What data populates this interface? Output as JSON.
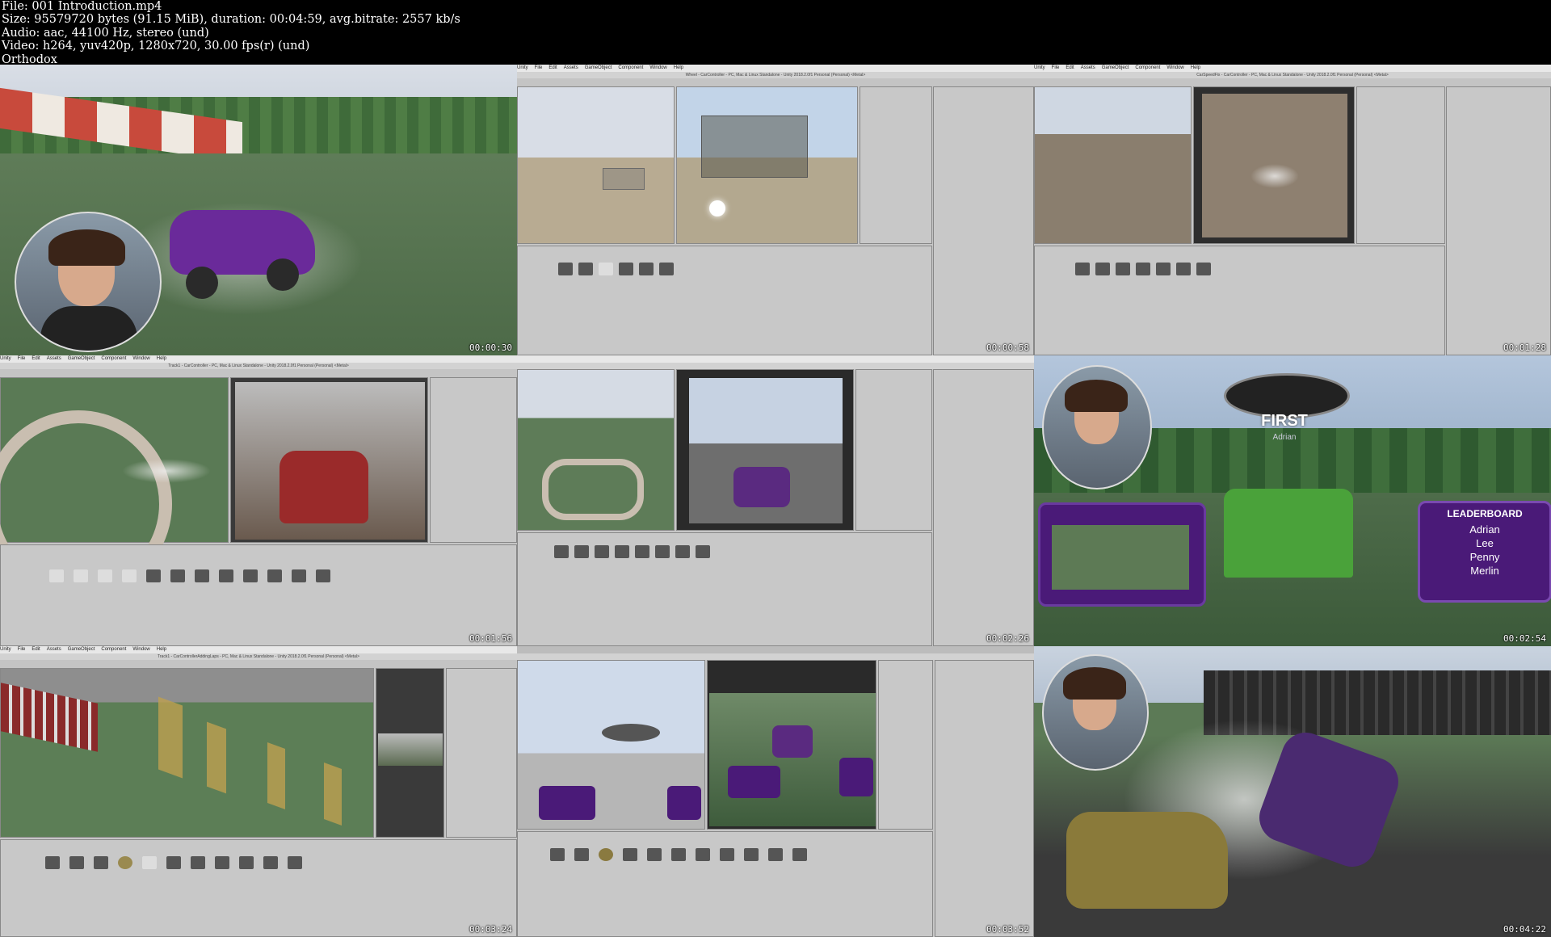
{
  "header": {
    "file": "File: 001 Introduction.mp4",
    "size": "Size: 95579720 bytes (91.15 MiB), duration: 00:04:59, avg.bitrate: 2557 kb/s",
    "audio": "Audio: aac, 44100 Hz, stereo (und)",
    "video": "Video: h264, yuv420p, 1280x720, 30.00 fps(r) (und)",
    "author": "Orthodox"
  },
  "thumbnails": [
    {
      "timestamp": "00:00:30"
    },
    {
      "timestamp": "00:00:58"
    },
    {
      "timestamp": "00:01:28"
    },
    {
      "timestamp": "00:01:56"
    },
    {
      "timestamp": "00:02:26"
    },
    {
      "timestamp": "00:02:54"
    },
    {
      "timestamp": "00:03:24"
    },
    {
      "timestamp": "00:03:52"
    },
    {
      "timestamp": "00:04:22"
    }
  ],
  "unity_menu": [
    "Unity",
    "File",
    "Edit",
    "Assets",
    "GameObject",
    "Component",
    "Window",
    "Help"
  ],
  "window_titles": {
    "t2": "Wheel - CarController - PC, Mac & Linux Standalone - Unity 2018.2.0f1 Personal (Personal) <Metal>",
    "t3": "CarSpeedFix - CarController - PC, Mac & Linux Standalone - Unity 2018.2.0f1 Personal (Personal) <Metal>",
    "t4": "Track1 - CarController - PC, Mac & Linux Standalone - Unity 2018.2.0f1 Personal (Personal) <Metal>",
    "t7": "Track1 - CarControllerAddingLaps - PC, Mac & Linux Standalone - Unity 2018.2.0f1 Personal (Personal) <Metal>"
  },
  "race_hud": {
    "position": "FIRST",
    "player": "Adrian",
    "leaderboard_title": "LEADERBOARD",
    "leaderboard": [
      "Adrian",
      "Lee",
      "Penny",
      "Merlin"
    ]
  },
  "colors": {
    "header_bg": "#000000",
    "header_text": "#ffffff",
    "purple_car": "#6a2a9a",
    "hud_purple": "#4a1a78",
    "unity_panel": "#c8c8c8",
    "grass": "#5d7a58"
  }
}
